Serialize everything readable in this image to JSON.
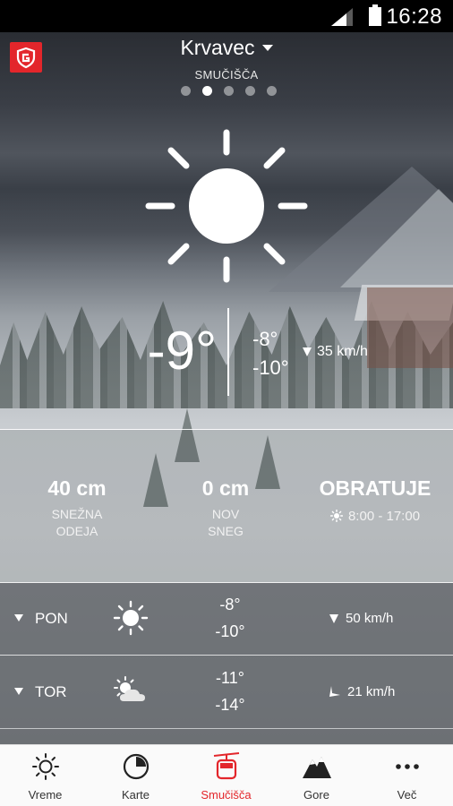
{
  "status_bar": {
    "time": "16:28"
  },
  "header": {
    "location": "Krvavec",
    "category": "SMUČIŠČA",
    "page_dots": {
      "count": 5,
      "active_index": 1
    }
  },
  "current": {
    "icon": "sun-icon",
    "temperature": "-9°",
    "high": "-8°",
    "low": "-10°",
    "wind": "35 km/h"
  },
  "stats": {
    "snow_depth": {
      "value": "40 cm",
      "label_line1": "SNEŽNA",
      "label_line2": "ODEJA"
    },
    "new_snow": {
      "value": "0 cm",
      "label_line1": "NOV",
      "label_line2": "SNEG"
    },
    "status": {
      "value": "OBRATUJE",
      "hours": "8:00 - 17:00"
    }
  },
  "forecast": [
    {
      "day": "PON",
      "icon": "sun-icon",
      "high": "-8°",
      "low": "-10°",
      "wind": "50 km/h"
    },
    {
      "day": "TOR",
      "icon": "partly-cloudy-icon",
      "high": "-11°",
      "low": "-14°",
      "wind": "21 km/h"
    }
  ],
  "tabs": [
    {
      "label": "Vreme",
      "icon": "sun-outline-icon"
    },
    {
      "label": "Karte",
      "icon": "map-dial-icon"
    },
    {
      "label": "Smučišča",
      "icon": "gondola-icon",
      "active": true
    },
    {
      "label": "Gore",
      "icon": "mountain-icon"
    },
    {
      "label": "Več",
      "icon": "more-dots-icon"
    }
  ],
  "colors": {
    "accent": "#e3262b",
    "tab_bg": "#fafafa",
    "text_light": "#ffffff"
  }
}
